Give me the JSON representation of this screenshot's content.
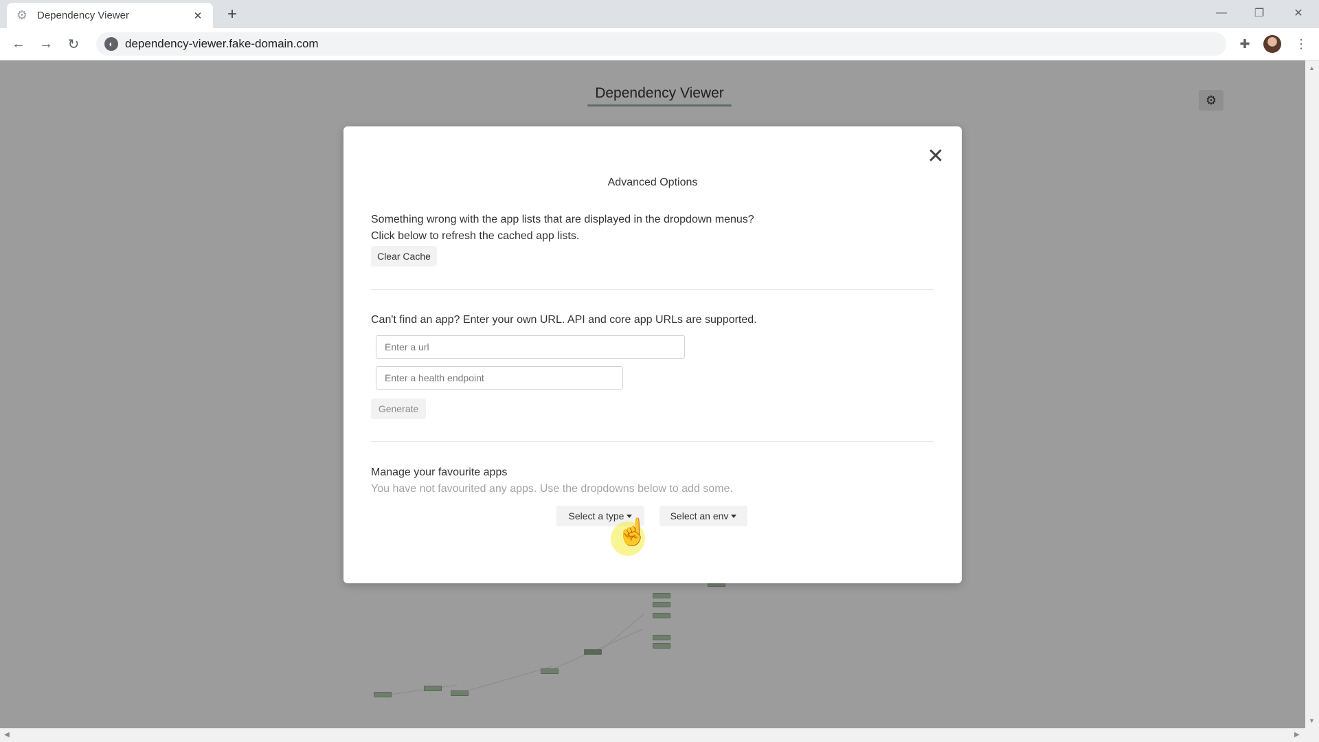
{
  "browser": {
    "tab_title": "Dependency Viewer",
    "tab_close": "✕",
    "new_tab": "+",
    "url": "dependency-viewer.fake-domain.com",
    "icons": {
      "favicon": "gear-icon",
      "back": "back-arrow-icon",
      "forward": "forward-arrow-icon",
      "reload": "reload-icon",
      "site_info": "globe-icon",
      "extensions": "puzzle-icon",
      "profile": "avatar",
      "menu": "kebab-menu-icon",
      "minimize": "minimize-icon",
      "maximize": "restore-icon",
      "close": "close-window-icon"
    }
  },
  "page": {
    "title": "Dependency Viewer",
    "settings_icon": "gear-icon"
  },
  "modal": {
    "title": "Advanced Options",
    "close_symbol": "✕",
    "cache_section": {
      "line1": "Something wrong with the app lists that are displayed in the dropdown menus?",
      "line2": "Click below to refresh the cached app lists.",
      "button": "Clear Cache"
    },
    "url_section": {
      "prompt": "Can't find an app? Enter your own URL. API and core app URLs are supported.",
      "url_placeholder": "Enter a url",
      "url_value": "",
      "health_placeholder": "Enter a health endpoint",
      "health_value": "",
      "button": "Generate"
    },
    "favourites_section": {
      "heading": "Manage your favourite apps",
      "empty_message": "You have not favourited any apps. Use the dropdowns below to add some.",
      "type_dropdown": "Select a type",
      "env_dropdown": "Select an env"
    }
  },
  "colors": {
    "overlay_background": "#9c9c9c",
    "title_underline": "#5f6e5f",
    "graph_node": "#6f7e6c",
    "cursor_highlight": "#f6ec3c"
  }
}
